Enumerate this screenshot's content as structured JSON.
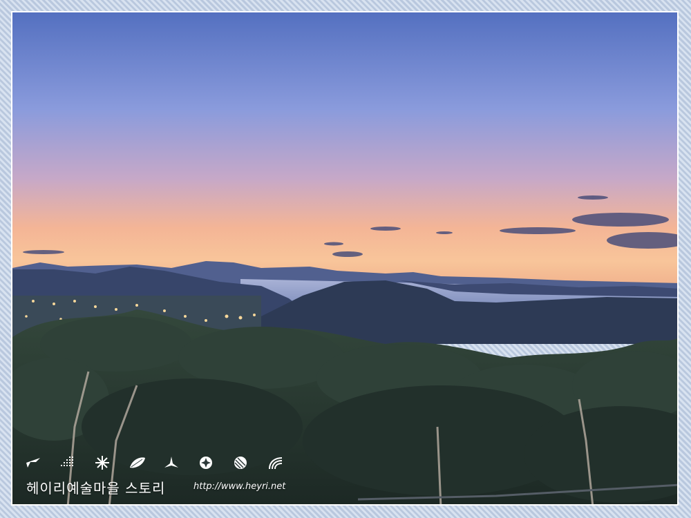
{
  "watermark": {
    "brand_text": "헤이리예술마을 스토리",
    "url_text": "http://www.heyri.net",
    "icons": [
      "flag-icon",
      "grid-dots-icon",
      "asterisk-icon",
      "leaf-icon",
      "tri-peak-icon",
      "circle-star-icon",
      "striped-ball-icon",
      "rainbow-arc-icon"
    ]
  },
  "colors": {
    "sky_top": "#5b74c4",
    "sky_mid": "#9ba5d9",
    "sky_glow": "#f7b08a",
    "horizon": "#f6c59c",
    "water": "#8b9bc8",
    "mountain_far": "#4d5a86",
    "hill_dark": "#2e3a58",
    "forest": "#26352f",
    "frame_light": "#d8e2f0"
  }
}
